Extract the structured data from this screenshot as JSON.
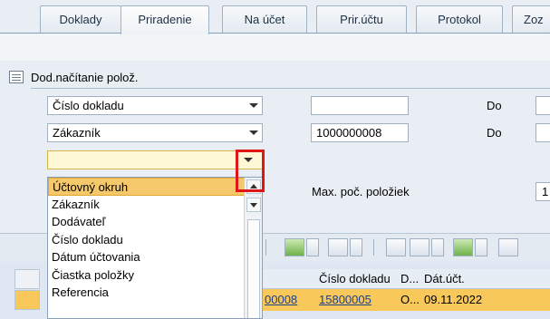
{
  "tabs": {
    "items": [
      "Doklady",
      "Priradenie",
      "Na účet",
      "Prir.účtu",
      "Protokol",
      "Zoz"
    ],
    "active": "Priradenie"
  },
  "group": {
    "title": "Dod.načítanie polož."
  },
  "criteria": {
    "row1": {
      "field": "Číslo dokladu",
      "value": "",
      "to_label": "Do"
    },
    "row2": {
      "field": "Zákazník",
      "value": "1000000008",
      "to_label": "Do"
    },
    "row3": {
      "field": ""
    }
  },
  "max_items": {
    "label": "Max. poč. položiek",
    "value": "1"
  },
  "dropdown": {
    "options": [
      "Účtovný okruh",
      "Zákazník",
      "Dodávateľ",
      "Číslo dokladu",
      "Dátum účtovania",
      "Čiastka položky",
      "Referencia"
    ],
    "selected": "Účtovný okruh"
  },
  "grid": {
    "columns": [
      "Číslo dokladu",
      "D...",
      "Dát.účt."
    ],
    "row": {
      "prefix": "00008",
      "doc_number": "15800005",
      "doc_type": "O...",
      "date": "09.11.2022"
    }
  },
  "colors": {
    "selected_row": "#f8c85a",
    "highlight": "#e01616",
    "dropdown_selected": "#f5c96b"
  }
}
